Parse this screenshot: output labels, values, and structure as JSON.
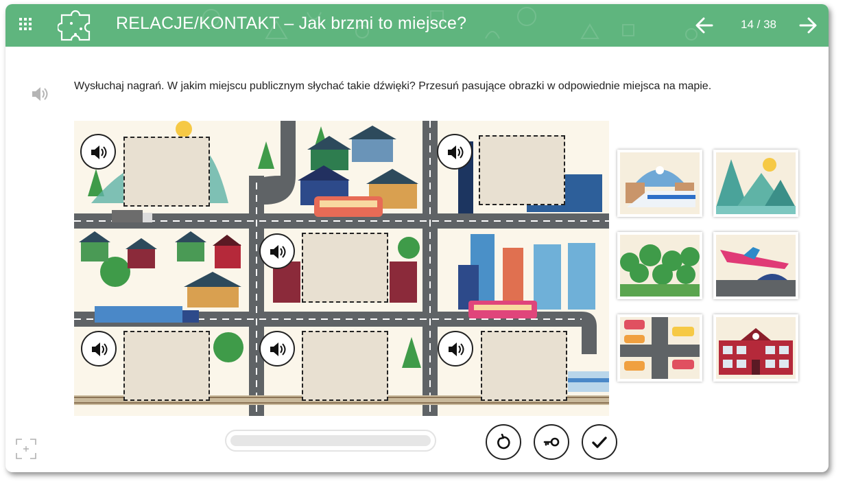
{
  "header": {
    "title": "RELACJE/KONTAKT – Jak brzmi to miejsce?",
    "page_current": 14,
    "page_total": 38,
    "pager_text": "14 / 38",
    "color": "#5fb57e",
    "icons": {
      "menu": "grid-menu-icon",
      "category": "puzzle-icon",
      "prev": "arrow-left-icon",
      "next": "arrow-right-icon"
    }
  },
  "instruction": {
    "text": "Wysłuchaj nagrań. W jakim miejscu publicznym słychać takie dźwięki? Przesuń pasujące obrazki w odpowiednie miejsca na mapie.",
    "icon": "speaker-icon"
  },
  "map": {
    "description_icons": [
      "mountain",
      "houses",
      "bus",
      "truck",
      "trees",
      "skyscrapers",
      "tram",
      "station",
      "railway"
    ],
    "slots": [
      {
        "id": 1,
        "sound_icon": "speaker-icon"
      },
      {
        "id": 2,
        "sound_icon": "speaker-icon"
      },
      {
        "id": 3,
        "sound_icon": "speaker-icon"
      },
      {
        "id": 4,
        "sound_icon": "speaker-icon"
      },
      {
        "id": 5,
        "sound_icon": "speaker-icon"
      },
      {
        "id": 6,
        "sound_icon": "speaker-icon"
      }
    ]
  },
  "tiles": [
    {
      "id": "train-station",
      "icon": "train-station-icon"
    },
    {
      "id": "mountains",
      "icon": "mountains-icon"
    },
    {
      "id": "forest",
      "icon": "forest-icon"
    },
    {
      "id": "airport",
      "icon": "airplane-icon"
    },
    {
      "id": "parking",
      "icon": "parking-lot-icon"
    },
    {
      "id": "school",
      "icon": "school-building-icon"
    }
  ],
  "progress": {
    "value": 0
  },
  "controls": {
    "reset": "reset-icon",
    "key": "key-icon",
    "check": "check-icon",
    "fullscreen": "fullscreen-icon"
  }
}
